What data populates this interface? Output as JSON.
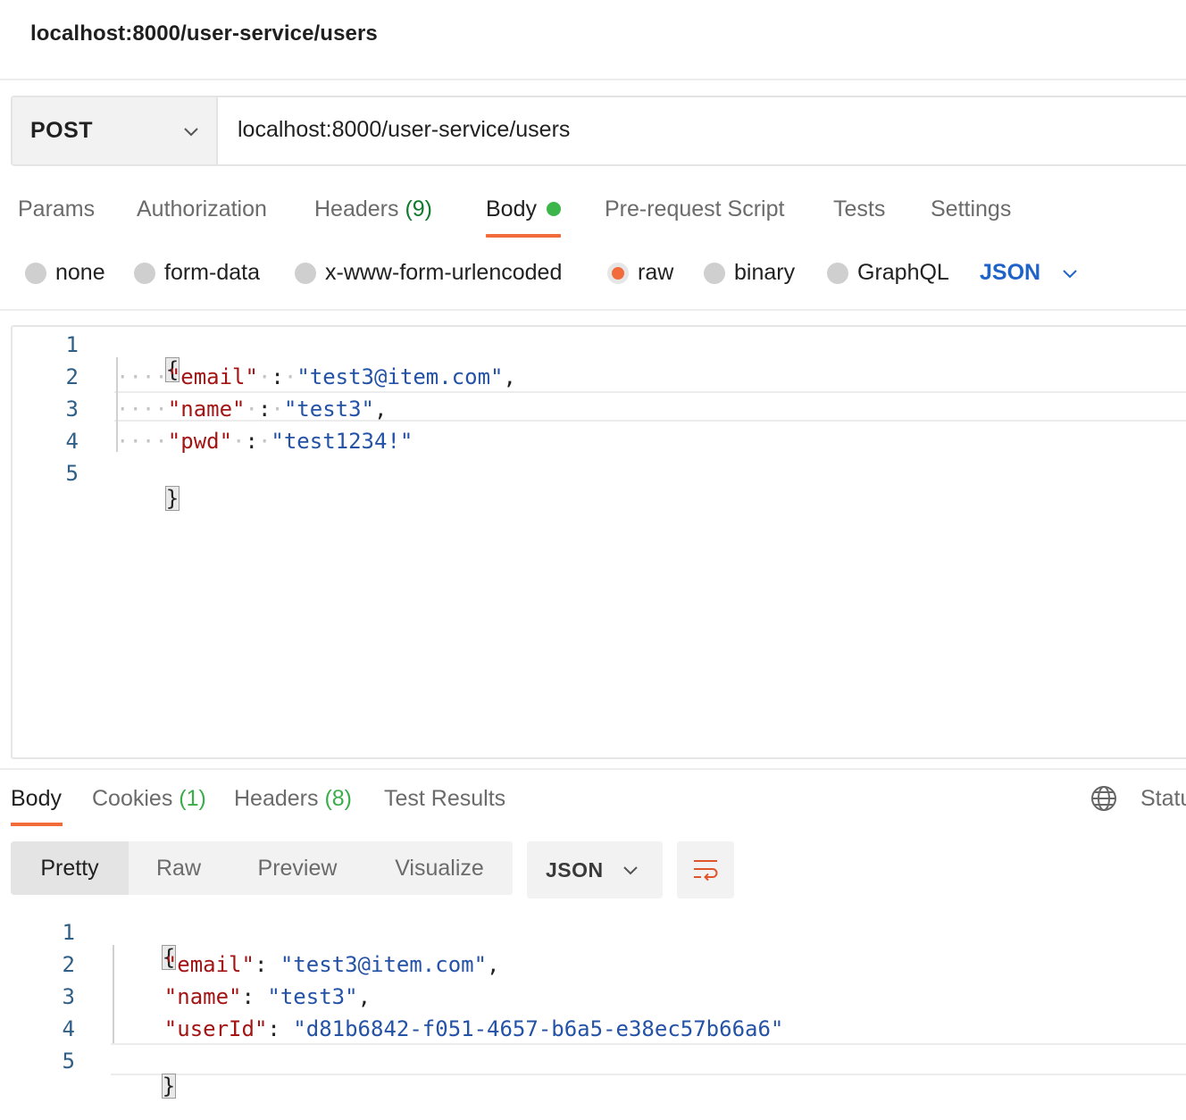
{
  "header": {
    "title": "localhost:8000/user-service/users"
  },
  "request": {
    "method": "POST",
    "url": "localhost:8000/user-service/users",
    "tabs": [
      {
        "label": "Params"
      },
      {
        "label": "Authorization"
      },
      {
        "label": "Headers",
        "count": "(9)"
      },
      {
        "label": "Body",
        "active": true
      },
      {
        "label": "Pre-request Script"
      },
      {
        "label": "Tests"
      },
      {
        "label": "Settings"
      }
    ],
    "body_types": [
      {
        "label": "none"
      },
      {
        "label": "form-data"
      },
      {
        "label": "x-www-form-urlencoded"
      },
      {
        "label": "raw",
        "selected": true
      },
      {
        "label": "binary"
      },
      {
        "label": "GraphQL"
      }
    ],
    "body_format": "JSON",
    "editor": {
      "line_numbers": [
        "1",
        "2",
        "3",
        "4",
        "5"
      ],
      "open_brace": "{",
      "close_brace": "}",
      "email_key": "\"email\"",
      "email_value": "\"test3@item.com\"",
      "name_key": "\"name\"",
      "name_value": "\"test3\"",
      "pwd_key": "\"pwd\"",
      "pwd_value": "\"test1234!\""
    }
  },
  "response": {
    "tabs": [
      {
        "label": "Body",
        "active": true
      },
      {
        "label": "Cookies",
        "count": "(1)"
      },
      {
        "label": "Headers",
        "count": "(8)"
      },
      {
        "label": "Test Results"
      }
    ],
    "status_label": "Statu",
    "view_modes": [
      "Pretty",
      "Raw",
      "Preview",
      "Visualize"
    ],
    "active_view": "Pretty",
    "format": "JSON",
    "editor": {
      "line_numbers": [
        "1",
        "2",
        "3",
        "4",
        "5"
      ],
      "open_brace": "{",
      "close_brace": "}",
      "email_key": "\"email\"",
      "email_value": "\"test3@item.com\"",
      "name_key": "\"name\"",
      "name_value": "\"test3\"",
      "userid_key": "\"userId\"",
      "userid_value": "\"d81b6842-f051-4657-b6a5-e38ec57b66a6\""
    }
  },
  "colors": {
    "accent": "#f26b3a",
    "json_key": "#a31515",
    "json_string": "#2452a6",
    "count_green": "#0f7b2e",
    "body_dot": "#3cb54a",
    "format_blue": "#1f63c9"
  },
  "icons": [
    "chevron-down-icon",
    "globe-icon",
    "wrap-lines-icon"
  ]
}
